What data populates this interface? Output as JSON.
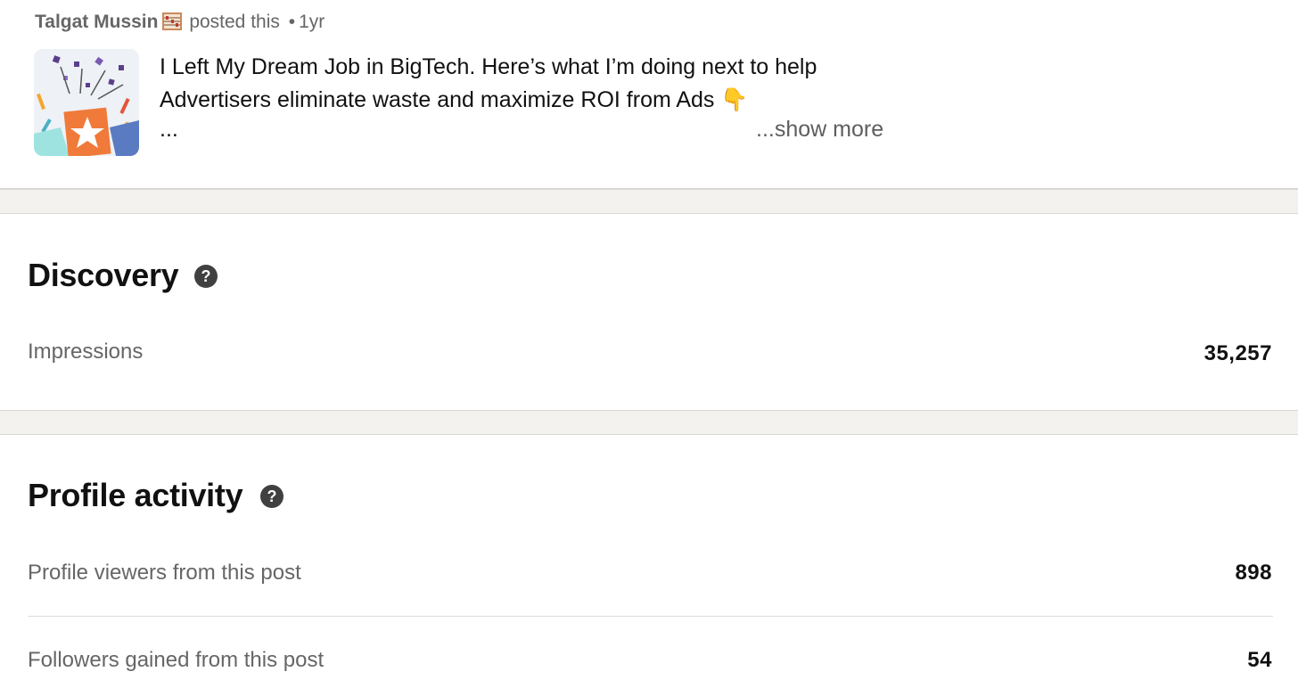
{
  "post": {
    "author": "Talgat Mussin",
    "author_badge_icon": "abacus-icon",
    "posted_label": "posted this",
    "separator": "•",
    "age": "1yr",
    "text_line1": "I Left My Dream Job in BigTech. Here’s what I’m doing next to help",
    "text_line2": "Advertisers eliminate waste and maximize ROI from Ads 👇",
    "text_line3": "...",
    "show_more_label": "...show more"
  },
  "discovery": {
    "title": "Discovery",
    "help_icon": "?",
    "metrics": [
      {
        "label": "Impressions",
        "value": "35,257"
      }
    ]
  },
  "profile_activity": {
    "title": "Profile activity",
    "help_icon": "?",
    "metrics": [
      {
        "label": "Profile viewers from this post",
        "value": "898"
      },
      {
        "label": "Followers gained from this post",
        "value": "54"
      }
    ]
  },
  "colors": {
    "separator_bg": "#f3f2ef",
    "muted_text": "#666666",
    "help_icon_bg": "#404040"
  }
}
